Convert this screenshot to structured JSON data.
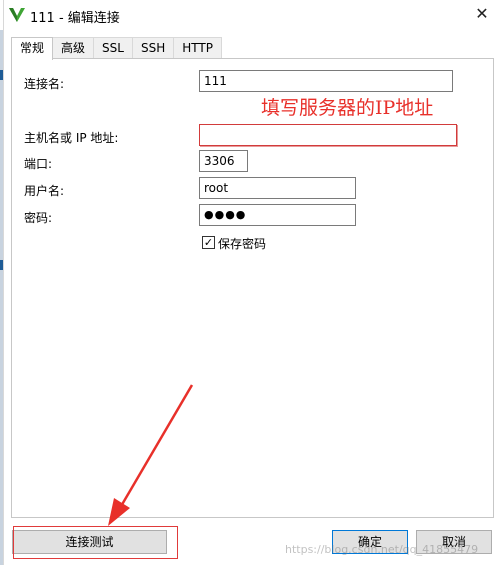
{
  "window": {
    "title": "111 - 编辑连接",
    "close_symbol": "✕"
  },
  "tabs": [
    {
      "label": "常规",
      "active": true
    },
    {
      "label": "高级",
      "active": false
    },
    {
      "label": "SSL",
      "active": false
    },
    {
      "label": "SSH",
      "active": false
    },
    {
      "label": "HTTP",
      "active": false
    }
  ],
  "form": {
    "connection_name": {
      "label": "连接名:",
      "value": "111"
    },
    "host": {
      "label": "主机名或 IP 地址:",
      "value": ""
    },
    "port": {
      "label": "端口:",
      "value": "3306"
    },
    "username": {
      "label": "用户名:",
      "value": "root"
    },
    "password": {
      "label": "密码:",
      "value": "●●●●"
    },
    "save_password": {
      "label": "保存密码",
      "checked": true,
      "check_symbol": "✓"
    }
  },
  "annotation": {
    "text": "填写服务器的IP地址",
    "color": "#e8302a"
  },
  "buttons": {
    "test": "连接测试",
    "ok": "确定",
    "cancel": "取消"
  },
  "watermark": "https://blog.csdn.net/qq_41855479"
}
